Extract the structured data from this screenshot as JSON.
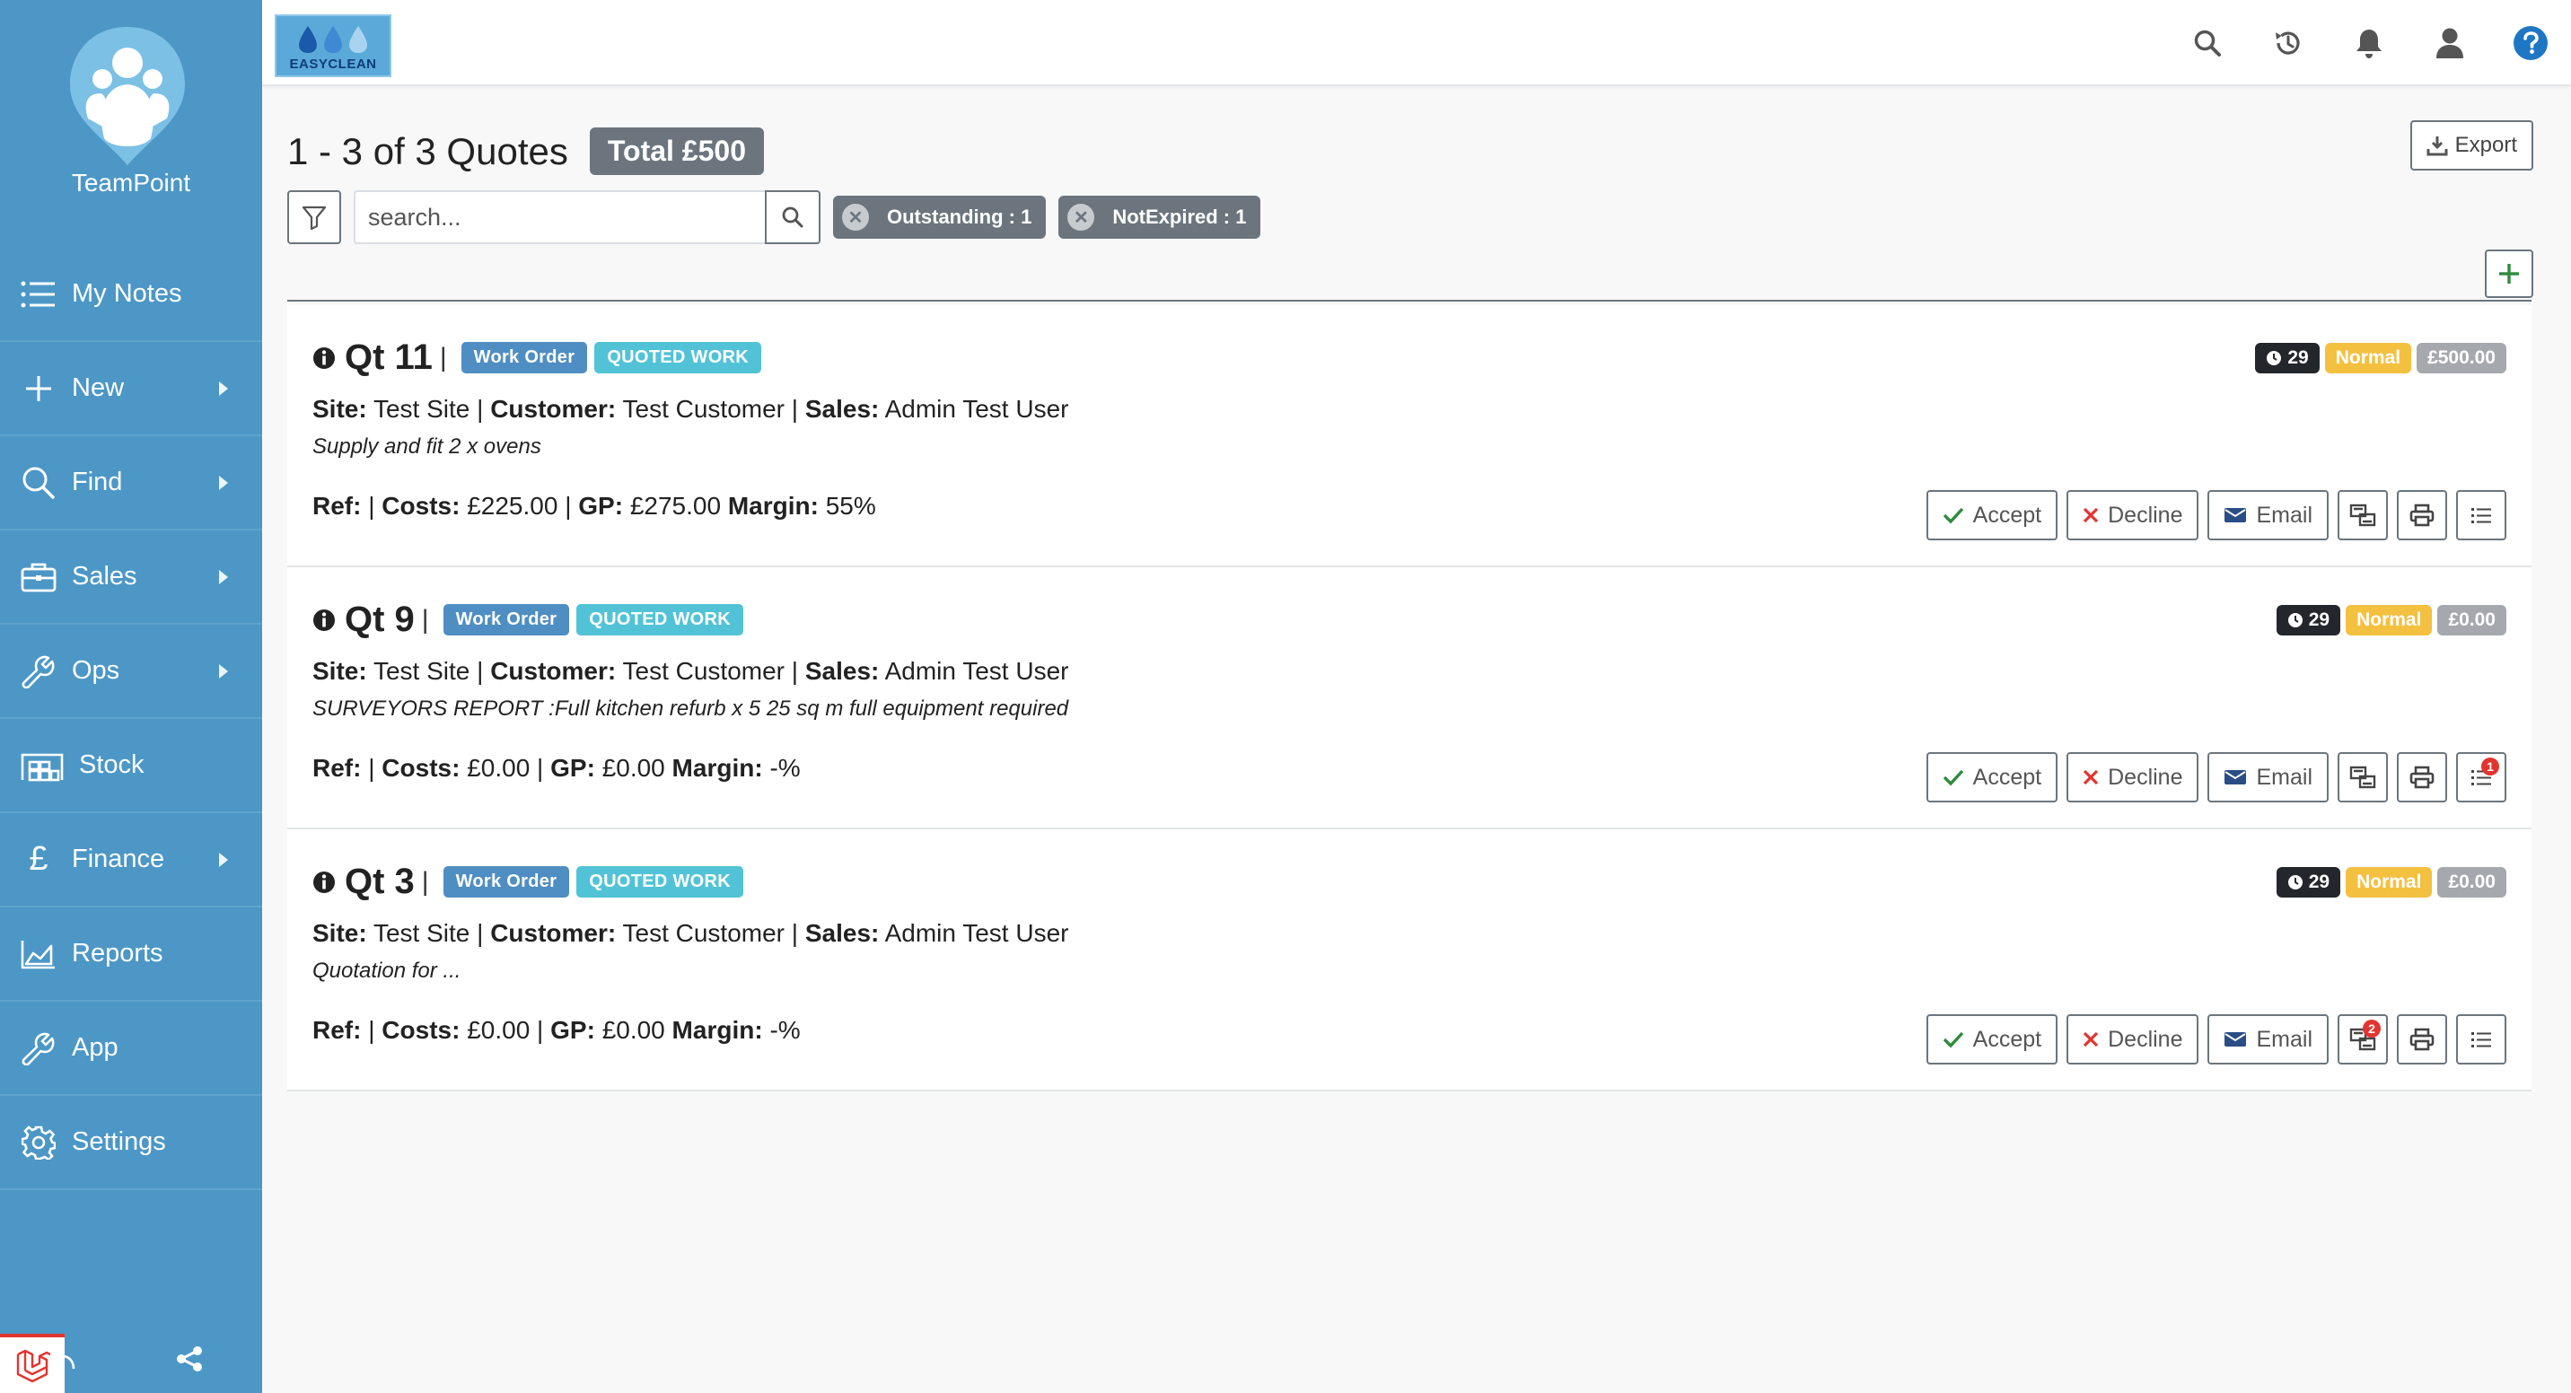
{
  "sidebar": {
    "brand_name": "TeamPoint",
    "items": [
      {
        "label": "My Notes",
        "icon": "list-icon",
        "has_arrow": false
      },
      {
        "label": "New",
        "icon": "plus-icon",
        "has_arrow": true
      },
      {
        "label": "Find",
        "icon": "search-icon",
        "has_arrow": true
      },
      {
        "label": "Sales",
        "icon": "briefcase-icon",
        "has_arrow": true
      },
      {
        "label": "Ops",
        "icon": "wrench-icon",
        "has_arrow": true
      },
      {
        "label": "Stock",
        "icon": "warehouse-icon",
        "has_arrow": false
      },
      {
        "label": "Finance",
        "icon": "pound-icon",
        "has_arrow": true
      },
      {
        "label": "Reports",
        "icon": "area-chart-icon",
        "has_arrow": false
      },
      {
        "label": "App",
        "icon": "wrench-icon",
        "has_arrow": false
      },
      {
        "label": "Settings",
        "icon": "gear-icon",
        "has_arrow": false
      }
    ]
  },
  "topbar": {
    "logo_text": "EASYCLEAN",
    "icons": [
      "search-icon",
      "history-icon",
      "bell-icon",
      "user-icon",
      "help-icon"
    ]
  },
  "main": {
    "title": "1 - 3 of 3 Quotes",
    "total": "Total £500",
    "export_label": "Export",
    "search": {
      "placeholder": "search...",
      "value": ""
    },
    "chips": [
      {
        "label": "Outstanding : 1"
      },
      {
        "label": "NotExpired : 1"
      }
    ]
  },
  "quotes": [
    {
      "number": "Qt 11",
      "badge_type": "Work Order",
      "badge_status": "QUOTED WORK",
      "site_label": "Site:",
      "site": "Test Site",
      "customer_label": "Customer:",
      "customer": "Test Customer",
      "sales_label": "Sales:",
      "sales": "Admin Test User",
      "description": "Supply and fit 2 x ovens",
      "ref_label": "Ref:",
      "costs_label": "Costs:",
      "costs": "£225.00",
      "gp_label": "GP:",
      "gp": "£275.00",
      "margin_label": "Margin:",
      "margin": "55%",
      "days": "29",
      "priority": "Normal",
      "amount": "£500.00",
      "accept": "Accept",
      "decline": "Decline",
      "email": "Email",
      "list_badge": "",
      "transfer_badge": ""
    },
    {
      "number": "Qt 9",
      "badge_type": "Work Order",
      "badge_status": "QUOTED WORK",
      "site_label": "Site:",
      "site": "Test Site",
      "customer_label": "Customer:",
      "customer": "Test Customer",
      "sales_label": "Sales:",
      "sales": "Admin Test User",
      "description": "SURVEYORS REPORT :Full kitchen refurb x 5 25 sq m full equipment required",
      "ref_label": "Ref:",
      "costs_label": "Costs:",
      "costs": "£0.00",
      "gp_label": "GP:",
      "gp": "£0.00",
      "margin_label": "Margin:",
      "margin": "-%",
      "days": "29",
      "priority": "Normal",
      "amount": "£0.00",
      "accept": "Accept",
      "decline": "Decline",
      "email": "Email",
      "list_badge": "1",
      "transfer_badge": ""
    },
    {
      "number": "Qt 3",
      "badge_type": "Work Order",
      "badge_status": "QUOTED WORK",
      "site_label": "Site:",
      "site": "Test Site",
      "customer_label": "Customer:",
      "customer": "Test Customer",
      "sales_label": "Sales:",
      "sales": "Admin Test User",
      "description": "Quotation for ...",
      "ref_label": "Ref:",
      "costs_label": "Costs:",
      "costs": "£0.00",
      "gp_label": "GP:",
      "gp": "£0.00",
      "margin_label": "Margin:",
      "margin": "-%",
      "days": "29",
      "priority": "Normal",
      "amount": "£0.00",
      "accept": "Accept",
      "decline": "Decline",
      "email": "Email",
      "list_badge": "",
      "transfer_badge": "2"
    }
  ],
  "colors": {
    "sidebar": "#4c97c6",
    "work_order": "#4f8ec2",
    "quoted_work": "#52c3d6",
    "warning": "#f4c040",
    "danger": "#e3342f",
    "success": "#2e8b3e"
  }
}
